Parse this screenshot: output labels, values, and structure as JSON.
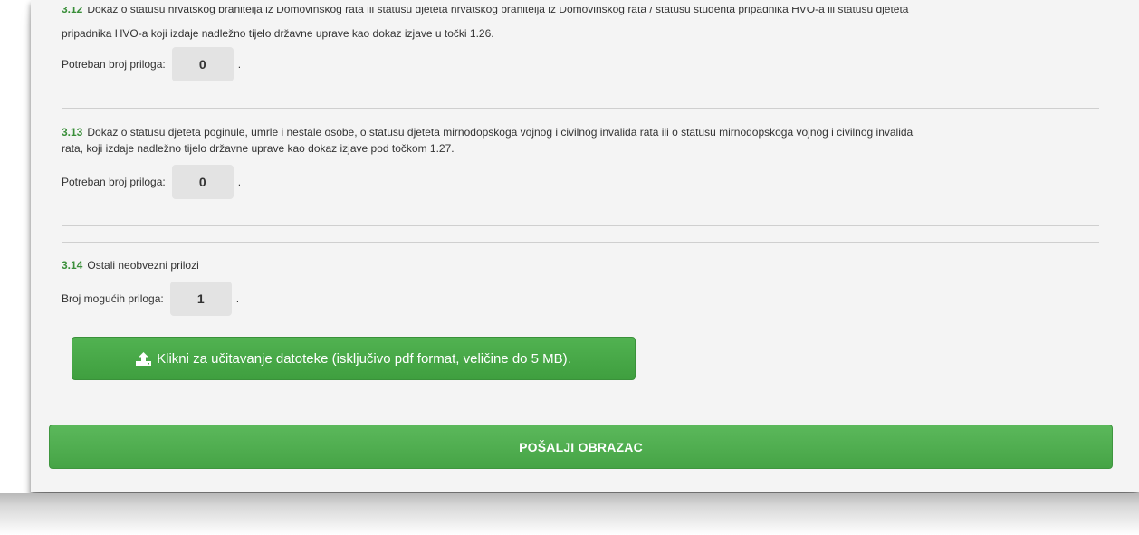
{
  "items": [
    {
      "number": "3.12",
      "desc_line1": "Dokaz o statusu hrvatskog branitelja iz Domovinskog rata ili statusu djeteta hrvatskog branitelja iz Domovinskog rata / statusu studenta pripadnika HVO-a ili statusu djeteta",
      "desc_line2": "pripadnika HVO-a koji izdaje nadležno tijelo državne uprave kao dokaz izjave u točki 1.26.",
      "count_label": "Potreban broj priloga:",
      "count_value": "0",
      "suffix": "."
    },
    {
      "number": "3.13",
      "desc_line1": "Dokaz o statusu djeteta poginule, umrle i nestale osobe, o statusu djeteta mirnodopskoga vojnog i civilnog invalida rata ili o statusu mirnodopskoga vojnog i civilnog invalida",
      "desc_line2": "rata, koji izdaje nadležno tijelo državne uprave kao dokaz izjave pod točkom 1.27.",
      "count_label": "Potreban broj priloga:",
      "count_value": "0",
      "suffix": "."
    },
    {
      "number": "3.14",
      "desc_line1": "Ostali neobvezni prilozi",
      "count_label": "Broj mogućih priloga:",
      "count_value": "1",
      "suffix": "."
    }
  ],
  "upload_button": {
    "icon": "upload-icon",
    "label": "Klikni za učitavanje datoteke (isključivo pdf format, veličine do 5 MB)."
  },
  "submit_button": {
    "label": "POŠALJI OBRAZAC"
  },
  "colors": {
    "accent_green": "#46a446",
    "number_green": "#3a8f3a",
    "card_bg": "#f4f4f4",
    "count_box_bg": "#e3e3e3"
  }
}
